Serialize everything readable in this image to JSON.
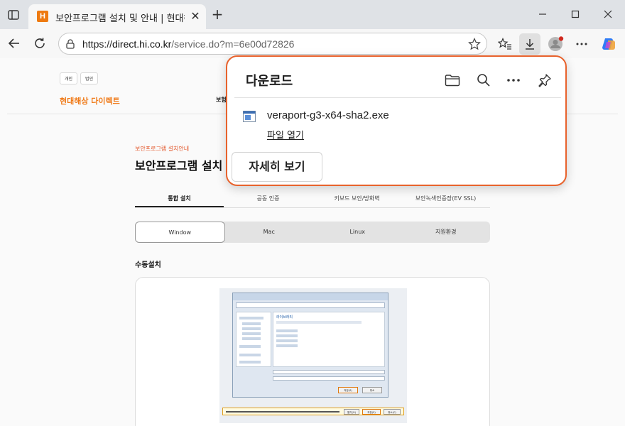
{
  "browser": {
    "tab": {
      "title": "보안프로그램 설치 및 안내 | 현대해상",
      "favicon_letter": "H"
    },
    "url": {
      "scheme": "https://",
      "host": "direct.hi.co.kr",
      "path": "/service.do?m=6e00d72826"
    }
  },
  "page": {
    "segment_tabs": [
      "개인",
      "법인"
    ],
    "brand": "현대해상 다이렉트",
    "nav_first": "보험",
    "breadcrumb": "보안프로그램 설치안내",
    "title": "보안프로그램 설치 안내",
    "main_tabs": [
      "통합 설치",
      "공동 인증",
      "키보드 보안/방화벽",
      "보안녹색인증장(EV SSL)"
    ],
    "os_tabs": [
      "Window",
      "Mac",
      "Linux",
      "지원환경"
    ],
    "section_title": "수동설치",
    "screenshot": {
      "library_title": "라이브러리",
      "ok_label": "저장(S)",
      "cancel_label": "취소",
      "bar_ok": "열기(O)",
      "bar_save": "저장(S)",
      "bar_cancel": "취소(C)"
    }
  },
  "downloads": {
    "title": "다운로드",
    "file_name": "veraport-g3-x64-sha2.exe",
    "open_link": "파일 열기",
    "details_button": "자세히 보기",
    "icons": [
      "folder-icon",
      "search-icon",
      "more-icon",
      "pin-icon"
    ]
  },
  "colors": {
    "accent": "#e8622c",
    "brand": "#f07b1a",
    "crumb": "#e3572b"
  }
}
